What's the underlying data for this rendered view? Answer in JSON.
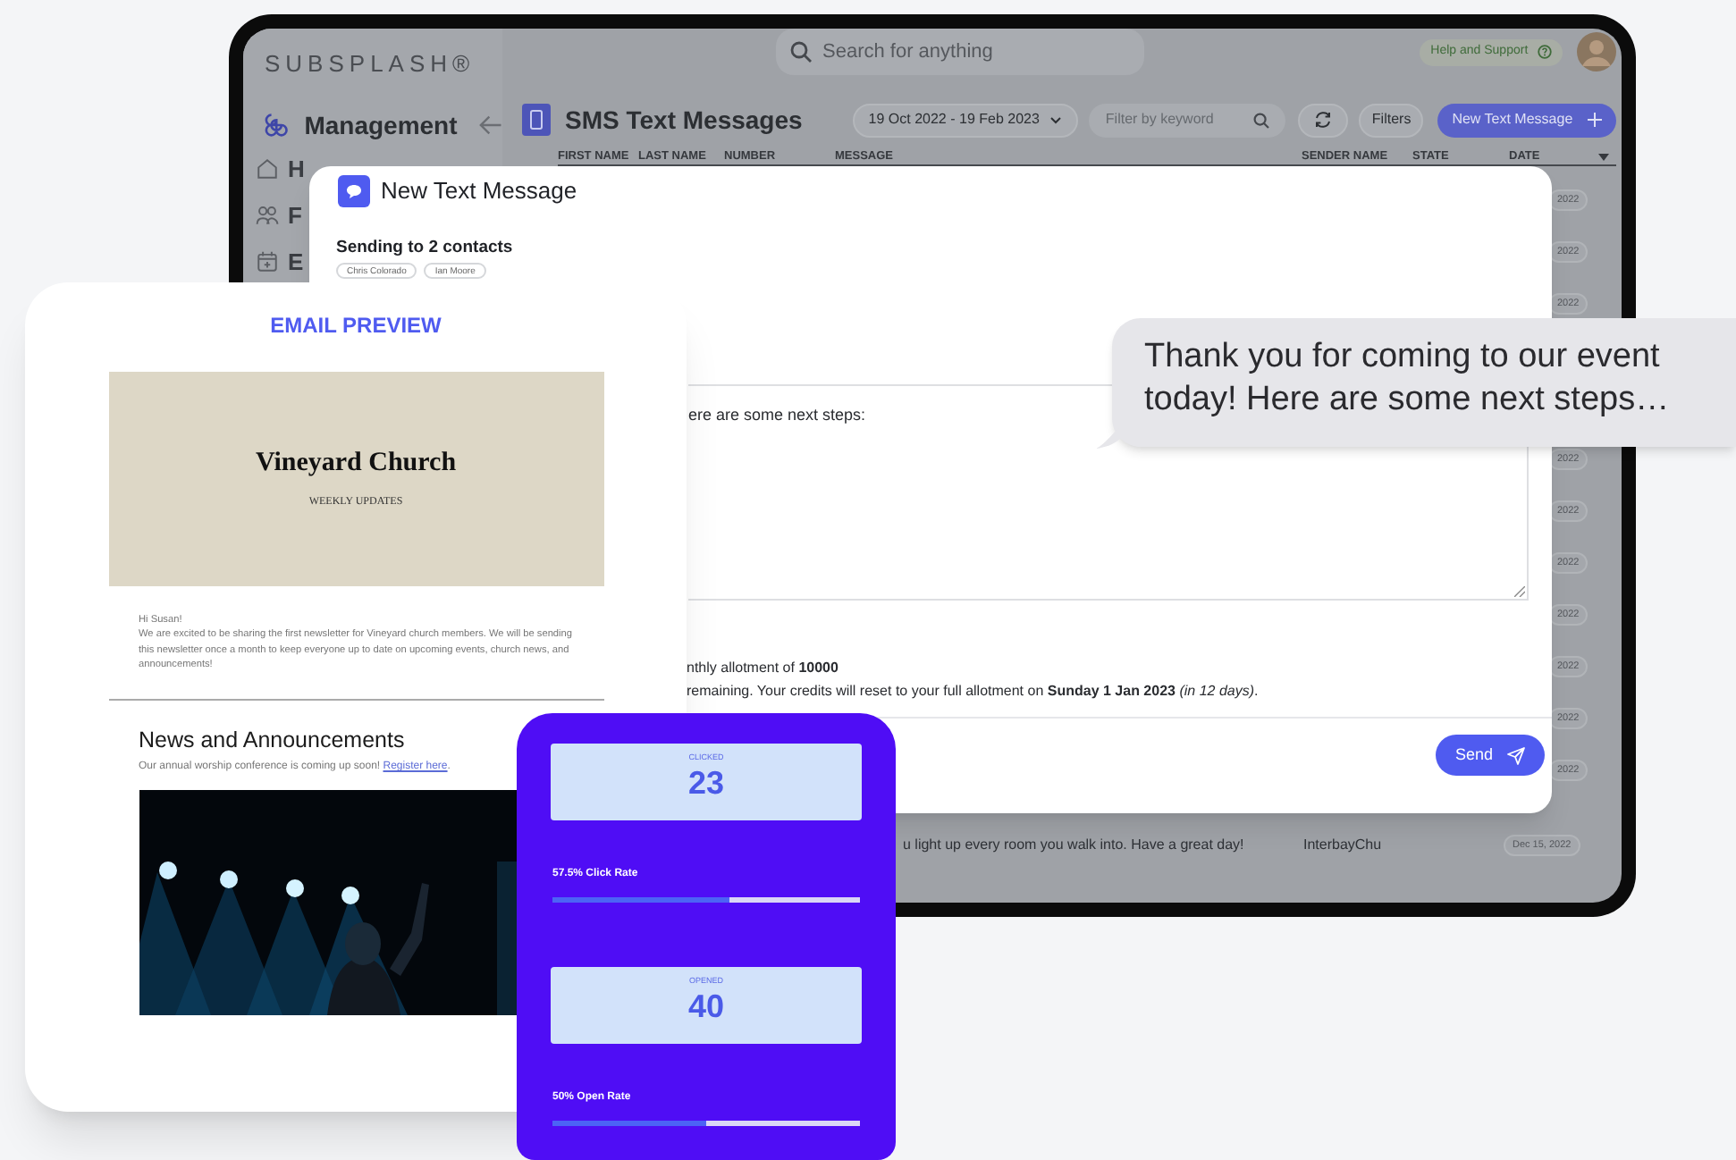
{
  "app": {
    "logo": "SUBSPLASH®",
    "section": "Management",
    "sidebar_items": [
      {
        "label": "H"
      },
      {
        "label": "F"
      },
      {
        "label": "E"
      }
    ],
    "search": {
      "placeholder": "Search for anything"
    },
    "help": "Help and Support",
    "page_title": "SMS Text Messages",
    "date_range": "19 Oct 2022 - 19 Feb 2023",
    "filter": {
      "placeholder": "Filter by keyword"
    },
    "filters_button": "Filters",
    "new_button": "New Text Message",
    "table": {
      "columns": [
        "FIRST NAME",
        "LAST NAME",
        "NUMBER",
        "MESSAGE",
        "SENDER NAME",
        "STATE",
        "DATE"
      ],
      "dates_above": [
        "2022",
        "2022",
        "2022"
      ],
      "dates_below": [
        "2022",
        "2022",
        "2022",
        "2022",
        "2022",
        "2022",
        "2022"
      ],
      "last_row": {
        "message": "u light up every room you walk into. Have a great day!",
        "sender": "InterbayChu",
        "date": "Dec 15, 2022"
      }
    }
  },
  "modal": {
    "title": "New Text Message",
    "recipients_heading": "Sending to 2 contacts",
    "chips": [
      "Chris Colorado",
      "Ian Moore"
    ],
    "message": "ere are some next steps:",
    "allotment_lines": [
      "nthly allotment of **10000**",
      "remaining. Your credits will reset to your full allotment on **Sunday 1 Jan 2023** *(in 12 days)*."
    ],
    "send_button": "Send"
  },
  "bubble": {
    "text": "Thank you for coming to our event today! Here are some next steps…"
  },
  "email_preview": {
    "title": "EMAIL PREVIEW",
    "church": "Vineyard Church",
    "subtitle": "WEEKLY UPDATES",
    "greeting": "Hi Susan!",
    "intro": "We are excited to be sharing the first newsletter for Vineyard church members. We will be sending this newsletter once a month to keep everyone up to date on upcoming events, church news, and announcements!",
    "section_heading": "News and Announcements",
    "section_text": "Our annual worship conference is coming up soon!",
    "link": "Register here",
    "link_suffix": "."
  },
  "stats": [
    {
      "label": "CLICKED",
      "value": "23",
      "rate": "57.5% Click Rate",
      "level": 0.575
    },
    {
      "label": "OPENED",
      "value": "40",
      "rate": "50% Open Rate",
      "level": 0.5
    }
  ]
}
